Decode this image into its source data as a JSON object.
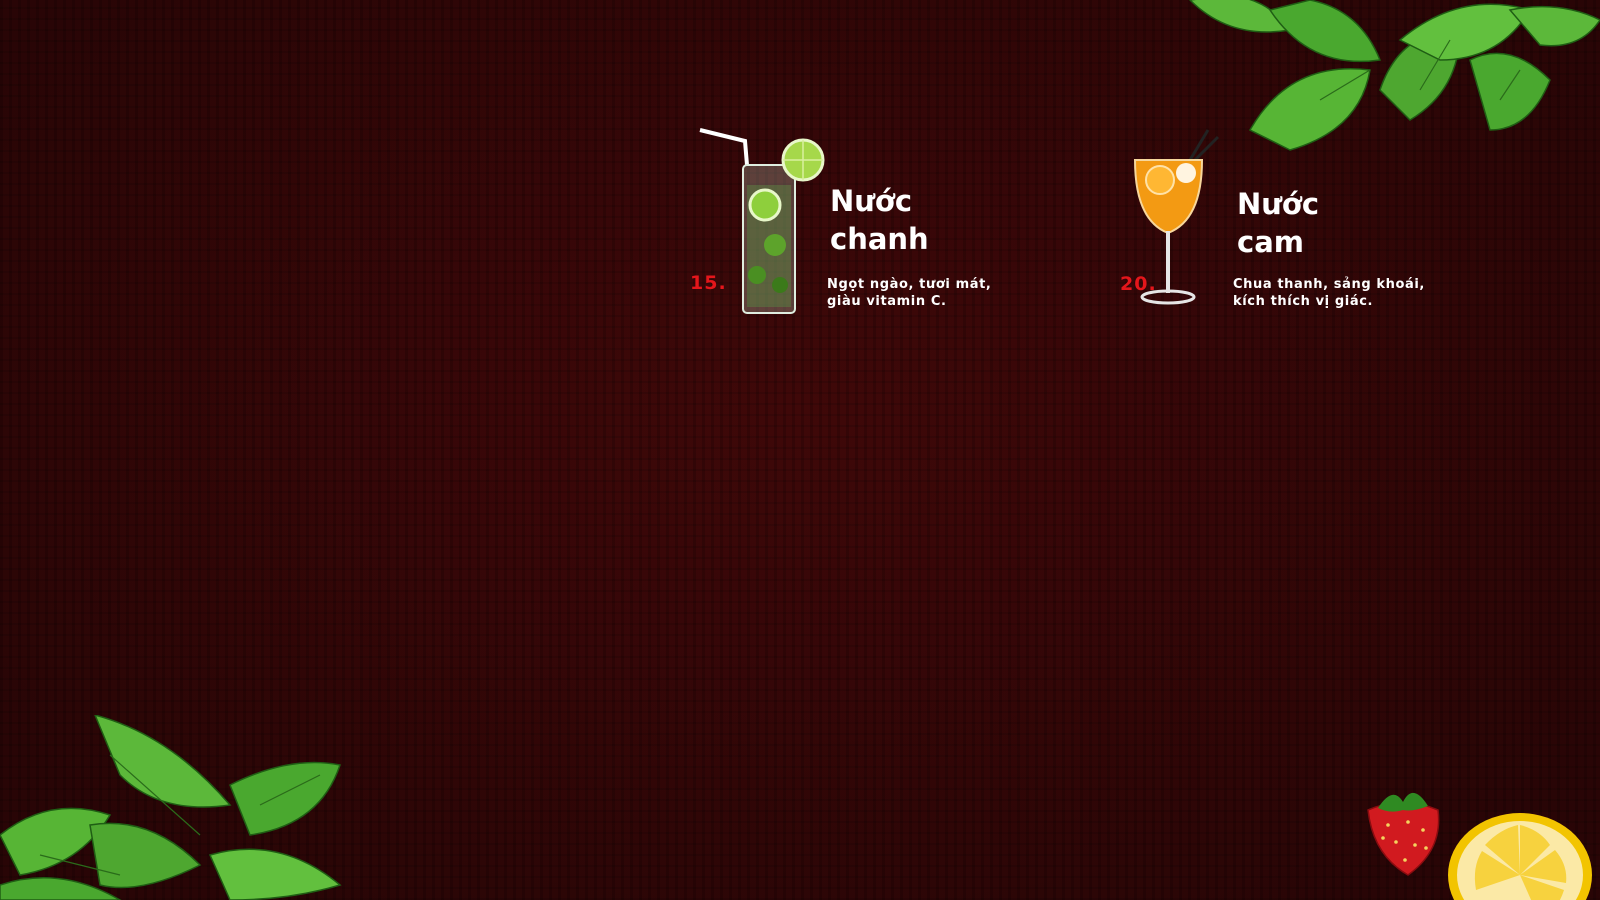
{
  "menu_items": [
    {
      "number": "15.",
      "title": "Nước\nchanh",
      "description": "Ngọt ngào, tươi mát,\ngiàu vitamin C.",
      "image_icon": "lemonade-glass-icon"
    },
    {
      "number": "20.",
      "title": "Nước\ncam",
      "description": "Chua thanh, sảng khoái,\nkích thích vị giác.",
      "image_icon": "orange-cocktail-glass-icon"
    }
  ],
  "decorations": {
    "top_right": "mint-leaves-icon",
    "bottom_left": "mint-leaves-icon",
    "bottom_right_1": "strawberry-icon",
    "bottom_right_2": "lemon-slice-icon"
  },
  "colors": {
    "background": "#3a0708",
    "number_accent": "#e4161b",
    "text": "#ffffff"
  }
}
